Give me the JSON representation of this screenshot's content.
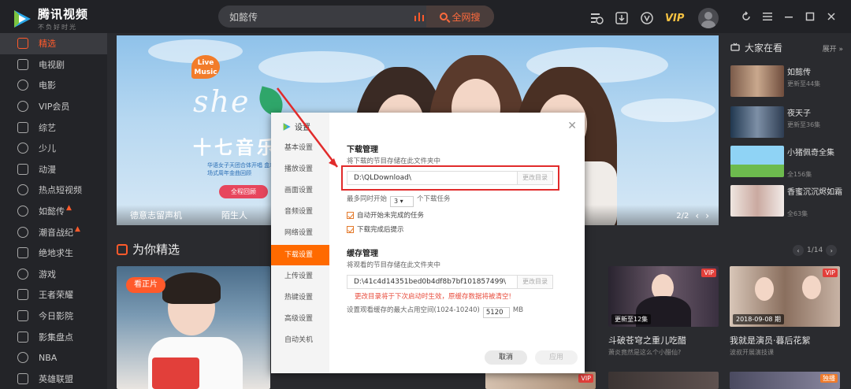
{
  "app": {
    "name": "腾讯视频",
    "slogan": "不负好时光"
  },
  "search": {
    "query": "如懿传",
    "button_label": "全网搜"
  },
  "topbar": {
    "vip_label": "VIP"
  },
  "sidebar": {
    "items": [
      {
        "label": "精选",
        "active": true
      },
      {
        "label": "电视剧"
      },
      {
        "label": "电影"
      },
      {
        "label": "VIP会员"
      },
      {
        "label": "综艺"
      },
      {
        "label": "少儿"
      },
      {
        "label": "动漫"
      },
      {
        "label": "热点短视频"
      },
      {
        "label": "如懿传",
        "hot": true
      },
      {
        "label": "潮音战纪",
        "hot": true
      },
      {
        "label": "绝地求生"
      },
      {
        "label": "游戏"
      },
      {
        "label": "王者荣耀"
      },
      {
        "label": "今日影院"
      },
      {
        "label": "影集盘点"
      },
      {
        "label": "NBA"
      },
      {
        "label": "英雄联盟"
      }
    ]
  },
  "banner": {
    "live_badge": "Live\nMusic",
    "she_logo": "she",
    "title": "十七音乐",
    "desc": "华语女子天团合体开唱 盒着场式周年金曲回顾",
    "button_label": "全程回顾",
    "captions": [
      "德意志留声机",
      "陌生人"
    ],
    "pager": "2/2"
  },
  "right_panel": {
    "title": "大家在看",
    "more": "展开",
    "items": [
      {
        "name": "如懿传",
        "sub": "更新至44集"
      },
      {
        "name": "夜天子",
        "sub": "更新至36集"
      },
      {
        "name": "小猪佩奇全集",
        "sub": "全156集"
      },
      {
        "name": "香蜜沉沉烬如霜",
        "sub": "全63集"
      }
    ]
  },
  "section": {
    "title": "为你精选",
    "pager": "1/14"
  },
  "cards": {
    "live_pill": "看正片",
    "card_doupo": {
      "title": "斗破苍穹之重儿吃醋",
      "sub": "萧炎竟然是这么个小醋仙?",
      "ep": "更新至12集",
      "vip": "VIP"
    },
    "card_actor": {
      "title": "我就是演员·暮后花絮",
      "sub": "波叔开展演技课",
      "ep": "2018-09-08 期",
      "vip": "VIP"
    },
    "tag_exclusive": "独播",
    "tag_vip": "VIP"
  },
  "dialog": {
    "title": "设置",
    "nav": [
      "基本设置",
      "播放设置",
      "画面设置",
      "音频设置",
      "网络设置",
      "下载设置",
      "上传设置",
      "热键设置",
      "高级设置",
      "自动关机"
    ],
    "active_index": 5,
    "download_heading": "下载管理",
    "download_desc": "将下载的节目存储在此文件夹中",
    "download_path": "D:\\QLDownload\\",
    "change_dir": "更改目录",
    "max_tasks_prefix": "最多同时开始",
    "max_tasks_value": "3",
    "max_tasks_suffix": "个下载任务",
    "auto_start": "自动开始未完成的任务",
    "notify_done": "下载完成后提示",
    "cache_heading": "缓存管理",
    "cache_desc": "将观看的节目存储在此文件夹中",
    "cache_path": "D:\\41c4d14351bed0b4df8b7bf101857499\\",
    "cache_warning": "更改目录将于下次启动时生效，原缓存数据将被清空!",
    "cache_size_label": "设置观看缓存的最大占用空间(1024-10240)",
    "cache_size_value": "5120",
    "cache_size_unit": "MB",
    "cancel_label": "取消",
    "apply_label": "应用"
  },
  "colors": {
    "accent": "#ff5a2b",
    "dialog_active": "#ff6a00",
    "highlight_box": "#e12b2b",
    "warning": "#e84c3d"
  }
}
